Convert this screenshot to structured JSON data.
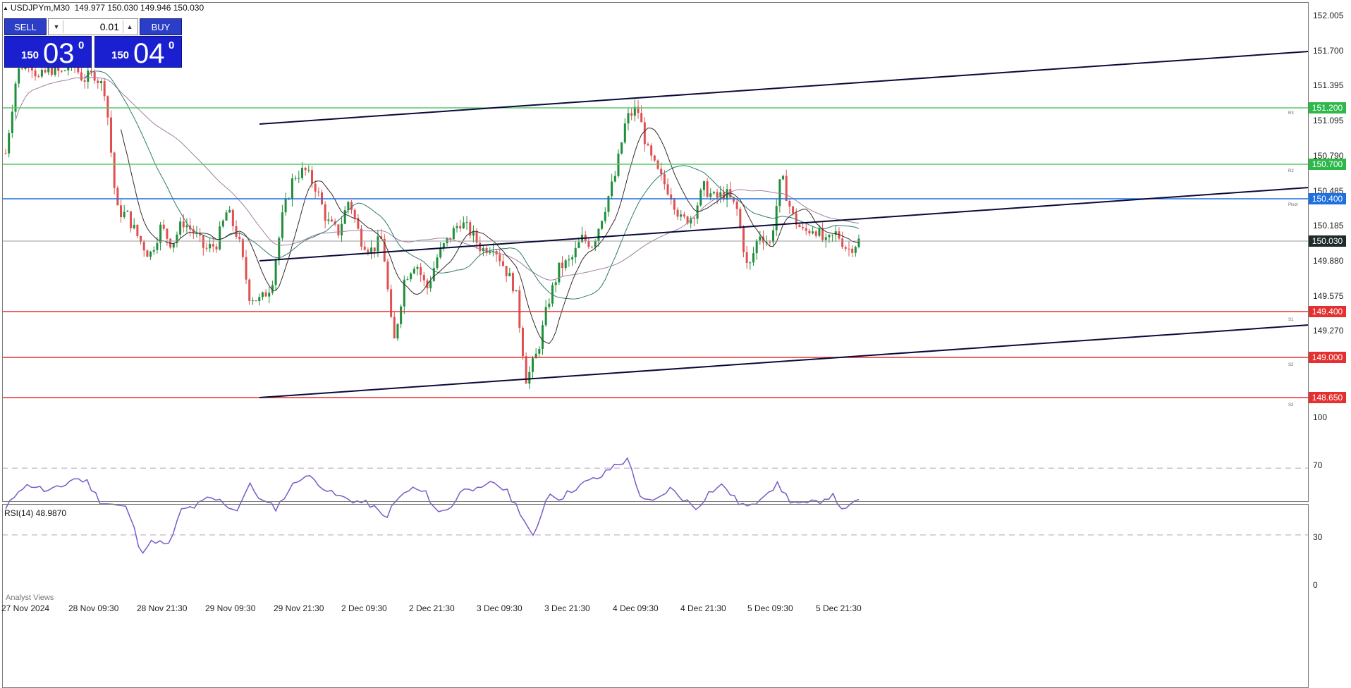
{
  "header": {
    "symbol": "USDJPYm,M30",
    "ohlc": "149.977 150.030 149.946 150.030"
  },
  "one_click": {
    "sell_label": "SELL",
    "buy_label": "BUY",
    "lot_value": "0.01",
    "sell_price": {
      "big": "150",
      "main": "03",
      "sup": "0"
    },
    "buy_price": {
      "big": "150",
      "main": "04",
      "sup": "0"
    }
  },
  "price_axis": [
    "152.005",
    "151.700",
    "151.395",
    "151.095",
    "150.790",
    "150.485",
    "150.185",
    "149.880",
    "149.575",
    "149.270"
  ],
  "level_tags": [
    {
      "label": "151.200",
      "color": "#2db84a"
    },
    {
      "label": "150.700",
      "color": "#2db84a"
    },
    {
      "label": "150.400",
      "color": "#1e6fe0"
    },
    {
      "label": "150.030",
      "color": "#1f2a2a"
    },
    {
      "label": "149.400",
      "color": "#e53030"
    },
    {
      "label": "149.000",
      "color": "#e53030"
    },
    {
      "label": "148.650",
      "color": "#e53030"
    }
  ],
  "pivot_labels": [
    "R3",
    "R2",
    "Pivot",
    "S1",
    "S2",
    "S3"
  ],
  "rsi": {
    "label": "RSI(14) 48.9870",
    "levels": [
      "100",
      "70",
      "30",
      "0"
    ]
  },
  "time_axis": [
    "27 Nov 2024",
    "28 Nov 09:30",
    "28 Nov 21:30",
    "29 Nov 09:30",
    "29 Nov 21:30",
    "2 Dec 09:30",
    "2 Dec 21:30",
    "3 Dec 09:30",
    "3 Dec 21:30",
    "4 Dec 09:30",
    "4 Dec 21:30",
    "5 Dec 09:30",
    "5 Dec 21:30"
  ],
  "bottom_tab": "Analyst Views",
  "colors": {
    "bull": "#1f8f3a",
    "bear": "#e05050",
    "rsi_line": "#7a5bc8",
    "ma_fast": "#3a2a2a",
    "ma_slow": "#2e7a6e",
    "ma_long": "#a080a0",
    "channel": "#0a0a3a"
  },
  "chart_data": {
    "type": "candlestick",
    "close_series": [
      150.8,
      151.5,
      151.65,
      151.45,
      151.55,
      151.5,
      151.6,
      151.45,
      151.5,
      151.35,
      150.3,
      150.25,
      150.05,
      149.9,
      150.15,
      150.0,
      150.2,
      150.1,
      149.95,
      150.0,
      150.3,
      150.05,
      149.55,
      149.5,
      149.65,
      150.25,
      150.6,
      150.65,
      150.5,
      150.2,
      150.1,
      150.4,
      150.05,
      149.95,
      150.05,
      149.1,
      149.7,
      149.85,
      149.6,
      149.9,
      150.05,
      150.2,
      150.1,
      149.95,
      150.0,
      149.8,
      149.6,
      148.8,
      149.05,
      149.5,
      149.8,
      149.85,
      150.05,
      150.0,
      150.3,
      150.6,
      151.1,
      151.2,
      150.8,
      150.6,
      150.45,
      150.2,
      150.25,
      150.5,
      150.4,
      150.45,
      150.3,
      149.75,
      150.1,
      150.0,
      150.6,
      150.25,
      150.1,
      150.15,
      150.0,
      150.1,
      149.95,
      150.03
    ],
    "levels": {
      "R3": 151.2,
      "R2": 150.7,
      "Pivot": 150.4,
      "S1": 149.4,
      "S2": 149.0,
      "S3": 148.65,
      "current": 150.03
    },
    "rsi_series": [
      45,
      58,
      60,
      56,
      58,
      64,
      62,
      50,
      48,
      46,
      20,
      27,
      23,
      45,
      47,
      52,
      50,
      44,
      60,
      50,
      46,
      58,
      66,
      62,
      55,
      52,
      50,
      48,
      40,
      52,
      58,
      55,
      43,
      48,
      60,
      56,
      62,
      56,
      44,
      27,
      55,
      52,
      58,
      62,
      65,
      72,
      75,
      50,
      50,
      58,
      52,
      46,
      56,
      60,
      50,
      46,
      55,
      60,
      50,
      48,
      50,
      54,
      44,
      52
    ],
    "rsi_levels": [
      70,
      30
    ],
    "ylim": [
      148.6,
      152.0
    ]
  }
}
